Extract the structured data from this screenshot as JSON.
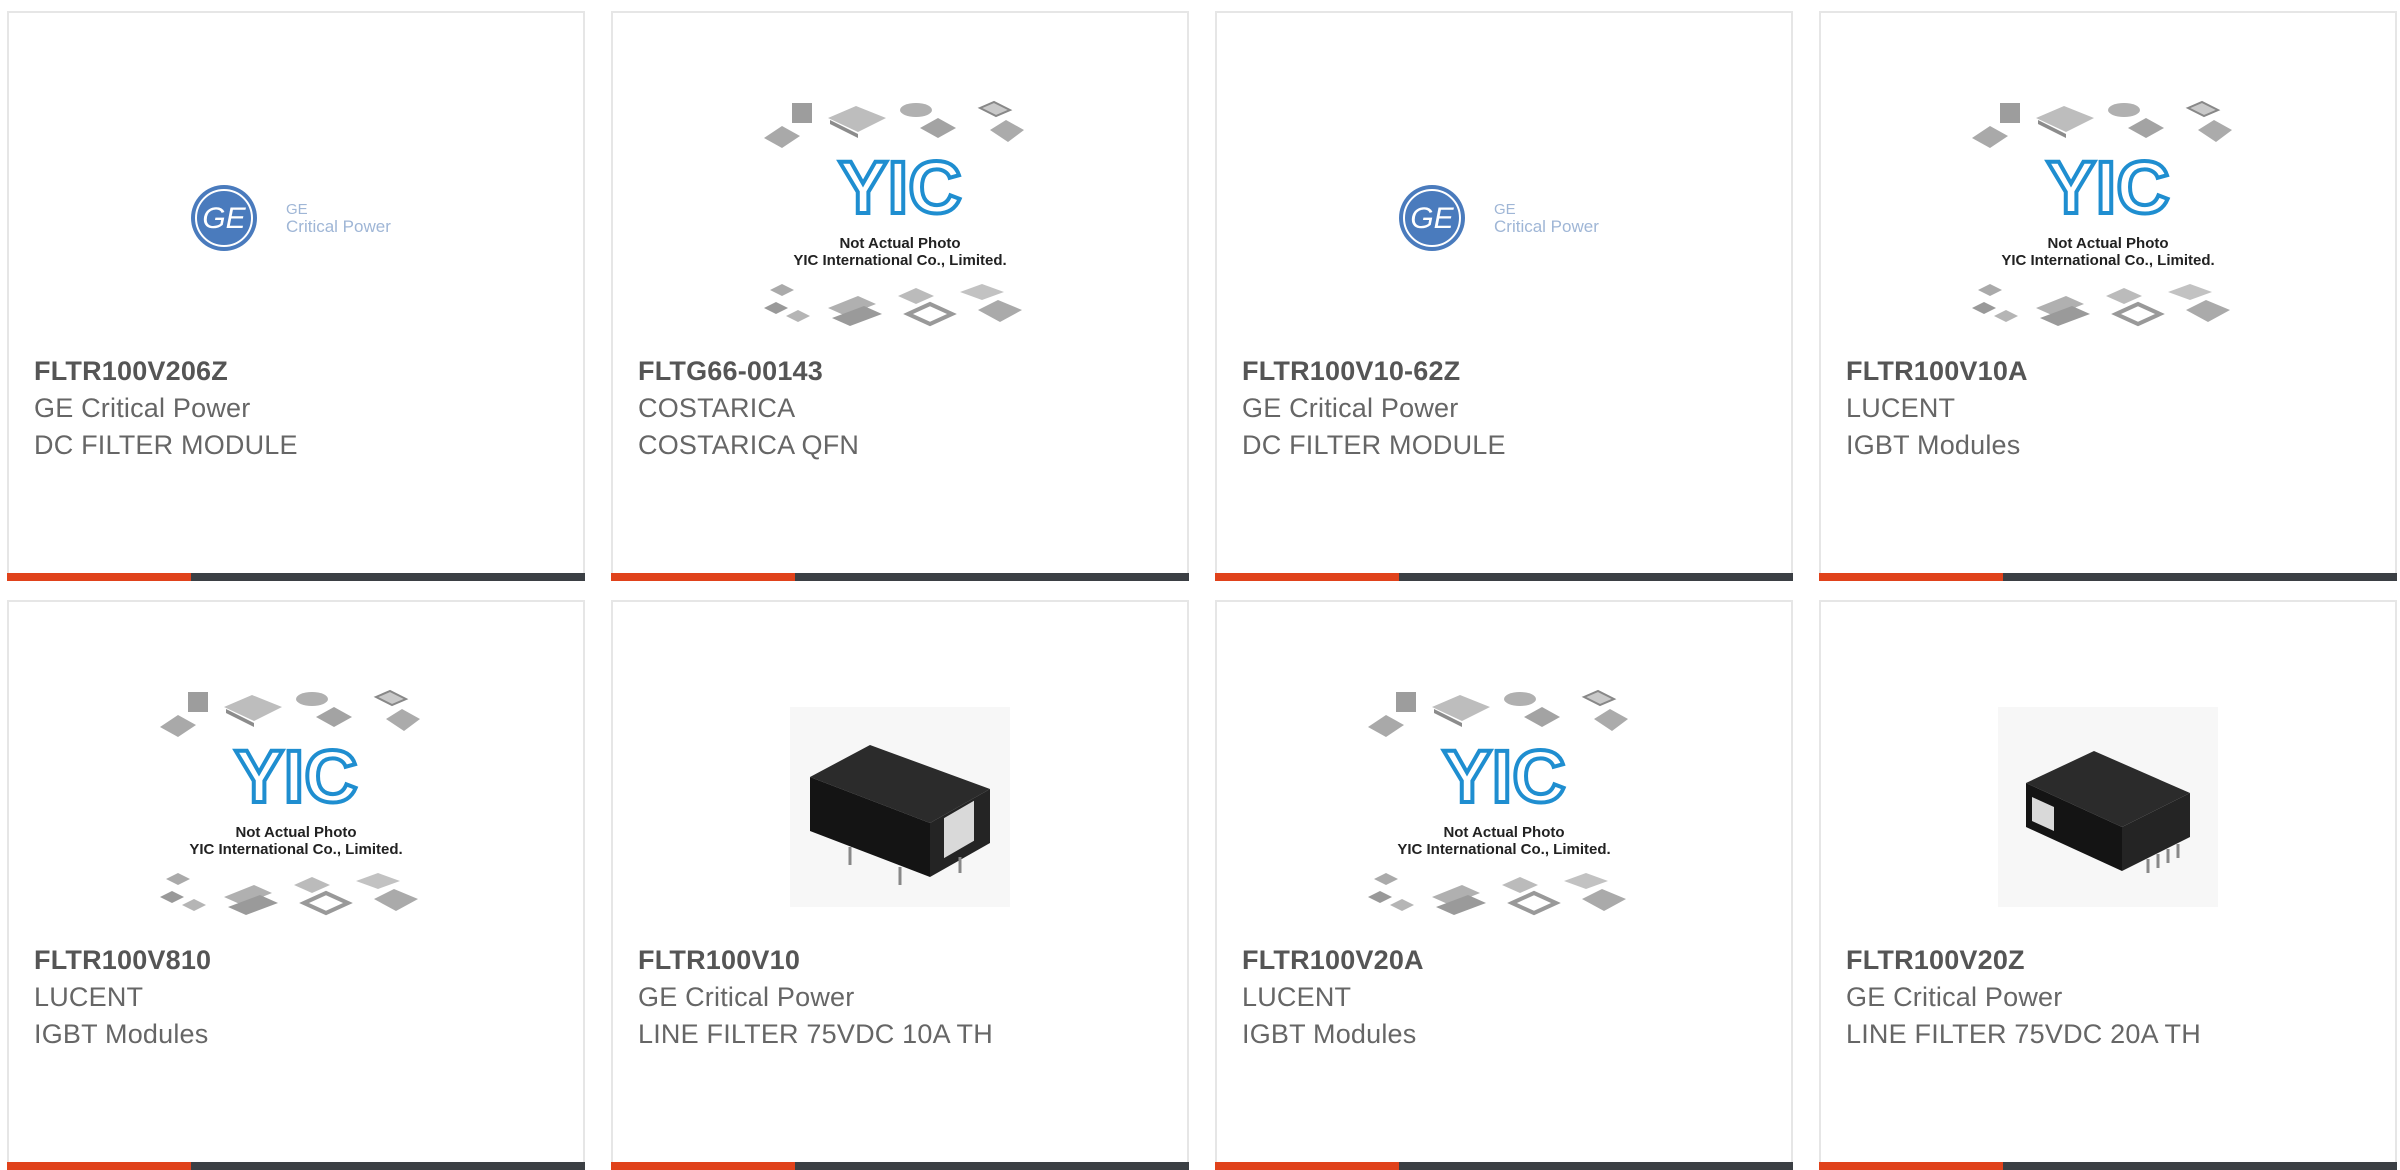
{
  "colors": {
    "accent": "#e0421b",
    "bar": "#3b3f44",
    "part_number": "#555555",
    "text": "#666666",
    "border": "#e6e6e6"
  },
  "placeholder": {
    "logo": "YIC",
    "line1": "Not Actual Photo",
    "line2": "YIC International Co., Limited."
  },
  "ge_logo": {
    "line1": "GE",
    "line2": "Critical Power"
  },
  "products": [
    {
      "part_number": "FLTR100V206Z",
      "manufacturer": "GE Critical Power",
      "description": "DC FILTER MODULE",
      "image": "ge-critical-power-logo"
    },
    {
      "part_number": "FLTG66-00143",
      "manufacturer": "COSTARICA",
      "description": "COSTARICA QFN",
      "image": "not-actual-photo-placeholder"
    },
    {
      "part_number": "FLTR100V10-62Z",
      "manufacturer": "GE Critical Power",
      "description": "DC FILTER MODULE",
      "image": "ge-critical-power-logo"
    },
    {
      "part_number": "FLTR100V10A",
      "manufacturer": "LUCENT",
      "description": "IGBT Modules",
      "image": "not-actual-photo-placeholder"
    },
    {
      "part_number": "FLTR100V810",
      "manufacturer": "LUCENT",
      "description": "IGBT Modules",
      "image": "not-actual-photo-placeholder"
    },
    {
      "part_number": "FLTR100V10",
      "manufacturer": "GE Critical Power",
      "description": "LINE FILTER 75VDC 10A TH",
      "image": "black-module-photo"
    },
    {
      "part_number": "FLTR100V20A",
      "manufacturer": "LUCENT",
      "description": "IGBT Modules",
      "image": "not-actual-photo-placeholder"
    },
    {
      "part_number": "FLTR100V20Z",
      "manufacturer": "GE Critical Power",
      "description": "LINE FILTER 75VDC 20A TH",
      "image": "black-module-photo"
    }
  ]
}
